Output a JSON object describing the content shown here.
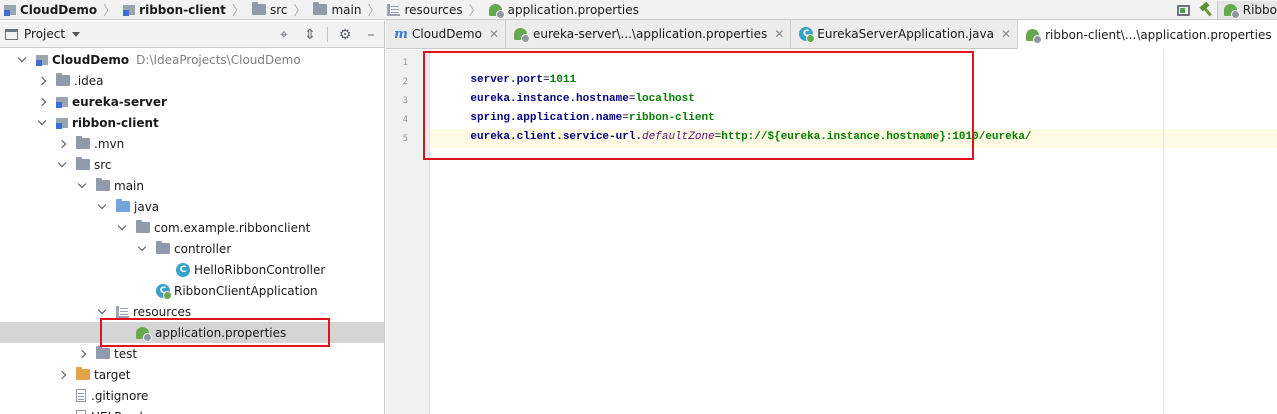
{
  "breadcrumbs": [
    {
      "label": "CloudDemo",
      "icon": "module-icon",
      "bold": true
    },
    {
      "label": "ribbon-client",
      "icon": "module-icon",
      "bold": true
    },
    {
      "label": "src",
      "icon": "folder-icon",
      "bold": false
    },
    {
      "label": "main",
      "icon": "folder-icon",
      "bold": false
    },
    {
      "label": "resources",
      "icon": "resources-folder-icon",
      "bold": false
    },
    {
      "label": "application.properties",
      "icon": "properties-file-icon",
      "bold": false
    }
  ],
  "run_config": {
    "label": "Ribbo"
  },
  "project_panel": {
    "title": "Project",
    "tree": [
      {
        "label": "CloudDemo",
        "path": "D:\\IdeaProjects\\CloudDemo",
        "depth": 0,
        "state": "expanded",
        "icon": "module-icon",
        "bold": true
      },
      {
        "label": ".idea",
        "depth": 1,
        "state": "collapsed",
        "icon": "folder-icon",
        "bold": false
      },
      {
        "label": "eureka-server",
        "depth": 1,
        "state": "collapsed",
        "icon": "module-icon",
        "bold": true
      },
      {
        "label": "ribbon-client",
        "depth": 1,
        "state": "expanded",
        "icon": "module-icon",
        "bold": true
      },
      {
        "label": ".mvn",
        "depth": 2,
        "state": "collapsed",
        "icon": "folder-icon",
        "bold": false
      },
      {
        "label": "src",
        "depth": 2,
        "state": "expanded",
        "icon": "folder-icon",
        "bold": false
      },
      {
        "label": "main",
        "depth": 3,
        "state": "expanded",
        "icon": "folder-icon",
        "bold": false
      },
      {
        "label": "java",
        "depth": 4,
        "state": "expanded",
        "icon": "source-folder-icon",
        "bold": false
      },
      {
        "label": "com.example.ribbonclient",
        "depth": 5,
        "state": "expanded",
        "icon": "package-icon",
        "bold": false
      },
      {
        "label": "controller",
        "depth": 6,
        "state": "expanded",
        "icon": "package-icon",
        "bold": false
      },
      {
        "label": "HelloRibbonController",
        "depth": 7,
        "state": "leaf",
        "icon": "java-class-icon",
        "bold": false
      },
      {
        "label": "RibbonClientApplication",
        "depth": 6,
        "state": "leaf",
        "icon": "spring-boot-class-icon",
        "bold": false
      },
      {
        "label": "resources",
        "depth": 4,
        "state": "expanded",
        "icon": "resources-folder-icon",
        "bold": false
      },
      {
        "label": "application.properties",
        "depth": 5,
        "state": "leaf",
        "icon": "properties-file-icon",
        "bold": false,
        "selected": true
      },
      {
        "label": "test",
        "depth": 3,
        "state": "collapsed",
        "icon": "folder-icon",
        "bold": false
      },
      {
        "label": "target",
        "depth": 2,
        "state": "collapsed",
        "icon": "excluded-folder-icon",
        "bold": false
      },
      {
        "label": ".gitignore",
        "depth": 2,
        "state": "leaf",
        "icon": "text-file-icon",
        "bold": false
      },
      {
        "label": "HELP.md",
        "depth": 2,
        "state": "leaf",
        "icon": "markdown-file-icon",
        "bold": false
      }
    ]
  },
  "editor": {
    "tabs": [
      {
        "label": "CloudDemo",
        "icon": "maven-icon",
        "active": false
      },
      {
        "label": "eureka-server\\...\\application.properties",
        "icon": "properties-file-icon",
        "active": false
      },
      {
        "label": "EurekaServerApplication.java",
        "icon": "spring-boot-class-icon",
        "active": false
      },
      {
        "label": "ribbon-client\\...\\application.properties",
        "icon": "properties-file-icon",
        "active": true
      }
    ],
    "line_numbers": [
      "1",
      "2",
      "3",
      "4",
      "5"
    ],
    "current_line": 5,
    "lines": [
      {
        "key": "server.port",
        "dotted": false,
        "eq": "=",
        "value": "1011",
        "italic_part": ""
      },
      {
        "key": "eureka.instance.hostname",
        "eq": "=",
        "value": "localhost",
        "italic_part": ""
      },
      {
        "key": "spring.application.name",
        "eq": "=",
        "value": "ribbon-client",
        "italic_part": ""
      },
      {
        "key": "eureka.client.service-url.",
        "eq": "=",
        "value": "http://${eureka.instance.hostname}:1010/eureka/",
        "italic_part": "defaultZone"
      },
      {
        "key": "",
        "eq": "",
        "value": "",
        "italic_part": ""
      }
    ]
  },
  "colors": {
    "highlight": "#e0141d",
    "key": "#000080",
    "value": "#008000",
    "italic_key": "#660e7a",
    "selection": "#d5d5d5",
    "current_line": "#fffae3"
  }
}
